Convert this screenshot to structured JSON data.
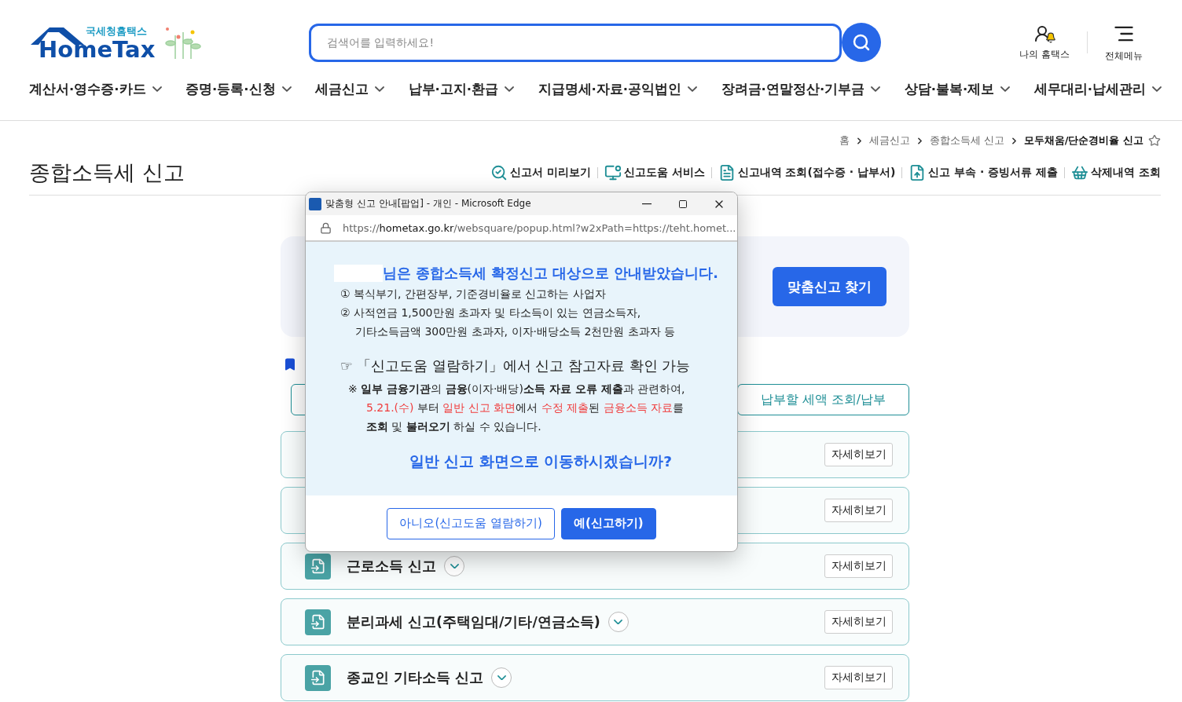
{
  "header": {
    "logo": {
      "small": "국세청홈택스",
      "main": "HomeTax"
    },
    "search": {
      "placeholder": "검색어를 입력하세요!"
    },
    "links": [
      {
        "kind": "user",
        "label": "나의 홈택스"
      },
      {
        "kind": "menu",
        "label": "전체메뉴"
      }
    ]
  },
  "nav": [
    {
      "label": "계산서·영수증·카드"
    },
    {
      "label": "증명·등록·신청"
    },
    {
      "label": "세금신고"
    },
    {
      "label": "납부·고지·환급"
    },
    {
      "label": "지급명세·자료·공익법인"
    },
    {
      "label": "장려금·연말정산·기부금"
    },
    {
      "label": "상담·불복·제보"
    },
    {
      "label": "세무대리·납세관리"
    }
  ],
  "breadcrumb": {
    "items": [
      "홈",
      "세금신고",
      "종합소득세 신고"
    ],
    "current": "모두채움/단순경비율 신고",
    "favorite": false
  },
  "page_title": "종합소득세 신고",
  "tools": [
    {
      "kind": "preview",
      "label": "신고서 미리보기"
    },
    {
      "kind": "help",
      "label": "신고도움 서비스"
    },
    {
      "kind": "history",
      "label": "신고내역 조회(접수증 · 납부서)"
    },
    {
      "kind": "upload",
      "label": "신고 부속 · 증빙서류 제출"
    },
    {
      "kind": "trash",
      "label": "삭제내역 조회"
    }
  ],
  "banner": {
    "button": "맞춤신고 찾기"
  },
  "action_buttons": [
    "납부할 세액 조회/납부"
  ],
  "cards": [
    {
      "button": "자세히보기"
    },
    {
      "button": "자세히보기"
    },
    {
      "title": "근로소득 신고",
      "button": "자세히보기"
    },
    {
      "title": "분리과세 신고(주택임대/기타/연금소득)",
      "button": "자세히보기"
    },
    {
      "title": "종교인 기타소득 신고",
      "button": "자세히보기"
    }
  ],
  "popup": {
    "title": "맞춤형 신고 안내[팝업] - 개인 - Microsoft Edge",
    "url": {
      "scheme": "https://",
      "domain": "hometax.go.kr",
      "path": "/websquare/popup.html?w2xPath=https://teht.homet..."
    },
    "headline": "님은 종합소득세 확정신고 대상으로 안내받았습니다.",
    "criteria": [
      {
        "text": "① 복식부기, 간편장부, 기준경비율로 신고하는 사업자",
        "continued": false
      },
      {
        "text": "② 사적연금 1,500만원 초과자 및 타소득이 있는 연금소득자,",
        "continued": false
      },
      {
        "text": "기타소득금액 300만원 초과자, 이자·배당소득 2천만원 초과자 등",
        "continued": true
      }
    ],
    "hint": "☞ 「신고도움 열람하기」에서 신고 참고자료 확인 가능",
    "note": [
      [
        {
          "text": "※ ",
          "kind": "plain"
        },
        {
          "text": "일부 금융기관",
          "kind": "bold"
        },
        {
          "text": "의 ",
          "kind": "plain"
        },
        {
          "text": "금융",
          "kind": "bold"
        },
        {
          "text": "(이자·배당)",
          "kind": "plain"
        },
        {
          "text": "소득 자료 오류 제출",
          "kind": "bold"
        },
        {
          "text": "과 관련하여,",
          "kind": "plain"
        }
      ],
      [
        {
          "text": "5.21.(수)",
          "kind": "red"
        },
        {
          "text": " 부터 ",
          "kind": "plain"
        },
        {
          "text": "일반 신고 화면",
          "kind": "red"
        },
        {
          "text": "에서 ",
          "kind": "plain"
        },
        {
          "text": "수정 제출",
          "kind": "red"
        },
        {
          "text": "된 ",
          "kind": "plain"
        },
        {
          "text": "금융소득 자료",
          "kind": "red"
        },
        {
          "text": "를",
          "kind": "plain"
        }
      ],
      [
        {
          "text": "조회",
          "kind": "bold"
        },
        {
          "text": " 및 ",
          "kind": "plain"
        },
        {
          "text": "불러오기",
          "kind": "bold"
        },
        {
          "text": " 하실 수 있습니다.",
          "kind": "plain"
        }
      ]
    ],
    "question": "일반 신고 화면으로 이동하시겠습니까?",
    "buttons": [
      {
        "kind": "secondary",
        "label": "아니오(신고도움 열람하기)"
      },
      {
        "kind": "primary",
        "label": "예(신고하기)"
      }
    ]
  }
}
